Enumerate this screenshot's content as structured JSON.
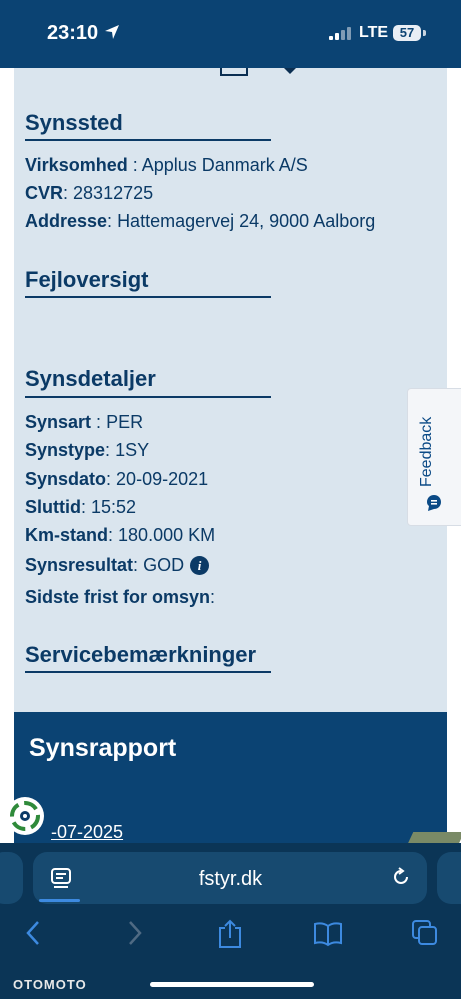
{
  "status": {
    "time": "23:10",
    "network": "LTE",
    "battery": "57"
  },
  "synssted": {
    "title": "Synssted",
    "rows": [
      {
        "label": "Virksomhed",
        "sep": " : ",
        "value": "Applus Danmark A/S"
      },
      {
        "label": "CVR",
        "sep": ": ",
        "value": "28312725"
      },
      {
        "label": "Addresse",
        "sep": ": ",
        "value": "Hattemagervej 24, 9000 Aalborg"
      }
    ]
  },
  "fejloversigt": {
    "title": "Fejloversigt"
  },
  "synsdetaljer": {
    "title": "Synsdetaljer",
    "rows": [
      {
        "label": "Synsart",
        "sep": " : ",
        "value": "PER"
      },
      {
        "label": "Synstype",
        "sep": ": ",
        "value": "1SY"
      },
      {
        "label": "Synsdato",
        "sep": ": ",
        "value": "20-09-2021"
      },
      {
        "label": "Sluttid",
        "sep": ": ",
        "value": "15:52"
      },
      {
        "label": "Km-stand",
        "sep": ": ",
        "value": "180.000 KM"
      },
      {
        "label": "Synsresultat",
        "sep": ": ",
        "value": "GOD"
      },
      {
        "label": "Sidste frist for omsyn",
        "sep": ":",
        "value": ""
      }
    ],
    "info_icon": "i"
  },
  "servicebemaerkninger": {
    "title": "Servicebemærkninger"
  },
  "feedback": {
    "label": "Feedback"
  },
  "synsrapport": {
    "title": "Synsrapport",
    "date": "-07-2025"
  },
  "browser": {
    "url": "fstyr.dk"
  },
  "watermark": "OTOMOTO",
  "colors": {
    "brand": "#0b4373",
    "panel": "#dae5ee",
    "text": "#0b3a66",
    "browser": "#0b3556",
    "link": "#3d8ae0"
  },
  "icons": {
    "location": "location-arrow-icon",
    "signal": "cellular-signal-icon",
    "tabs": "tab-overview-icon",
    "reload": "reload-icon",
    "back": "back-chevron-icon",
    "forward": "forward-chevron-icon",
    "share": "share-icon",
    "bookmarks": "bookmarks-icon",
    "all_tabs": "tabs-icon",
    "feedback": "chat-bubble-icon"
  }
}
